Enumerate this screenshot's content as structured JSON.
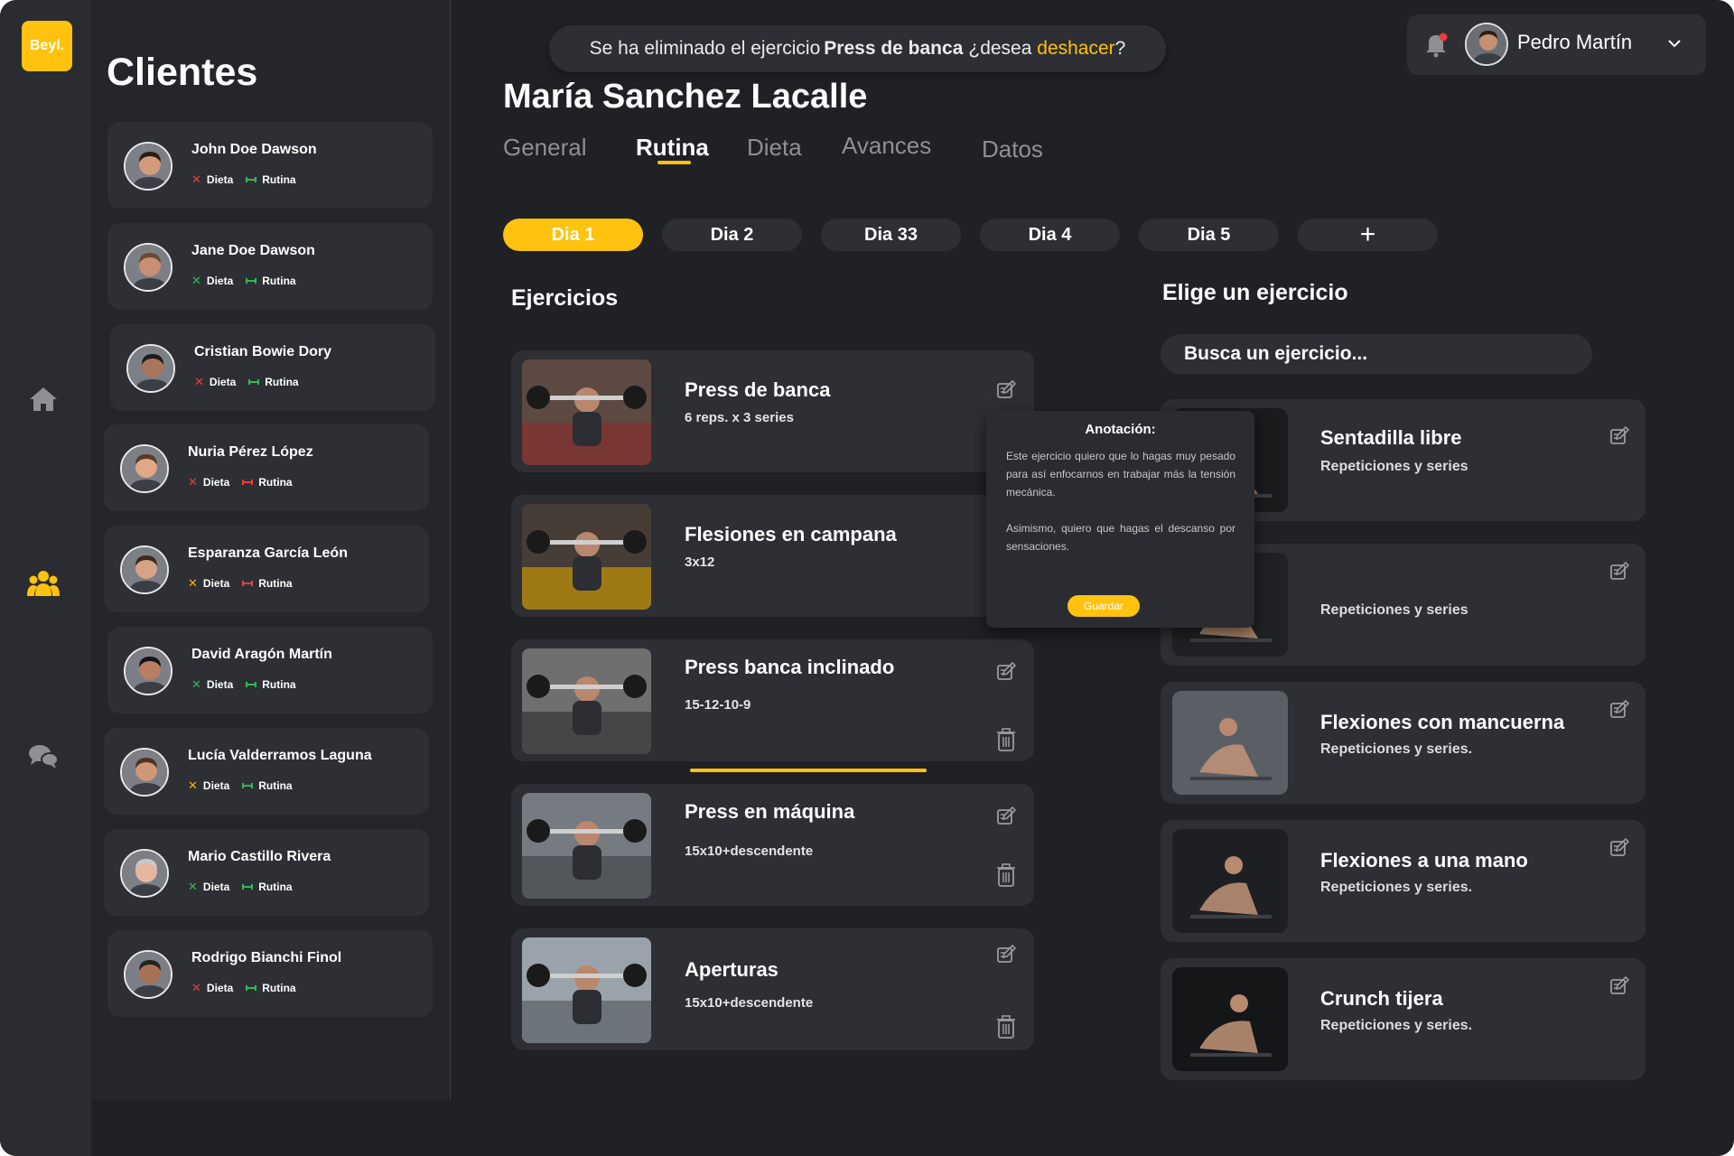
{
  "brand": {
    "logo_text": "Beyl.",
    "accent": "#ffc20e"
  },
  "clients": {
    "title": "Clientes",
    "items": [
      {
        "name": "John Doe Dawson",
        "dieta_label": "Dieta",
        "rutina_label": "Rutina",
        "dieta_status": "missing",
        "rutina_status": "ok"
      },
      {
        "name": "Jane Doe Dawson",
        "dieta_label": "Dieta",
        "rutina_label": "Rutina",
        "dieta_status": "ok",
        "rutina_status": "ok"
      },
      {
        "name": "Cristian Bowie Dory",
        "dieta_label": "Dieta",
        "rutina_label": "Rutina",
        "dieta_status": "missing",
        "rutina_status": "ok"
      },
      {
        "name": "Nuria Pérez López",
        "dieta_label": "Dieta",
        "rutina_label": "Rutina",
        "dieta_status": "missing",
        "rutina_status": "missing"
      },
      {
        "name": "Esparanza García León",
        "dieta_label": "Dieta",
        "rutina_label": "Rutina",
        "dieta_status": "pending",
        "rutina_status": "missing"
      },
      {
        "name": "David Aragón Martín",
        "dieta_label": "Dieta",
        "rutina_label": "Rutina",
        "dieta_status": "ok",
        "rutina_status": "ok"
      },
      {
        "name": "Lucía Valderramos Laguna",
        "dieta_label": "Dieta",
        "rutina_label": "Rutina",
        "dieta_status": "pending",
        "rutina_status": "ok"
      },
      {
        "name": "Mario Castillo Rivera",
        "dieta_label": "Dieta",
        "rutina_label": "Rutina",
        "dieta_status": "ok",
        "rutina_status": "ok"
      },
      {
        "name": "Rodrigo Bianchi Finol",
        "dieta_label": "Dieta",
        "rutina_label": "Rutina",
        "dieta_status": "missing",
        "rutina_status": "ok"
      }
    ]
  },
  "toast": {
    "prefix": "Se ha eliminado el ejercicio",
    "exercise": "Press de banca",
    "question": "¿desea",
    "undo": "deshacer",
    "suffix": "?"
  },
  "user": {
    "name": "Pedro Martín"
  },
  "patient": {
    "name": "María Sanchez Lacalle"
  },
  "tabs": [
    "General",
    "Rutina",
    "Dieta",
    "Avances",
    "Datos"
  ],
  "days": [
    "Dia 1",
    "Dia 2",
    "Dia 33",
    "Dia 4",
    "Dia 5",
    "+"
  ],
  "exercises": {
    "title": "Ejercicios",
    "items": [
      {
        "name": "Press de banca",
        "detail": "6 reps. x 3 series"
      },
      {
        "name": "Flesiones en campana",
        "detail": "3x12"
      },
      {
        "name": "Press banca inclinado",
        "detail": "15-12-10-9"
      },
      {
        "name": "Press en máquina",
        "detail": "15x10+descendente"
      },
      {
        "name": "Aperturas",
        "detail": "15x10+descendente"
      }
    ]
  },
  "annotation": {
    "title": "Anotación:",
    "paragraph1": "Este ejercicio quiero que lo hagas muy pesado para así enfocarnos en trabajar más la tensión mecánica.",
    "paragraph2": "Asimismo, quiero que hagas el descanso por sensaciones.",
    "save": "Guardar"
  },
  "catalog": {
    "title": "Elige un ejercicio",
    "search_placeholder": "Busca un ejercicio...",
    "items": [
      {
        "name": "Sentadilla libre",
        "detail": "Repeticiones y series"
      },
      {
        "name": "",
        "detail": "Repeticiones y series"
      },
      {
        "name": "Flexiones con mancuerna",
        "detail": "Repeticiones y series."
      },
      {
        "name": "Flexiones a una mano",
        "detail": "Repeticiones y series."
      },
      {
        "name": "Crunch tijera",
        "detail": "Repeticiones y series."
      }
    ]
  }
}
